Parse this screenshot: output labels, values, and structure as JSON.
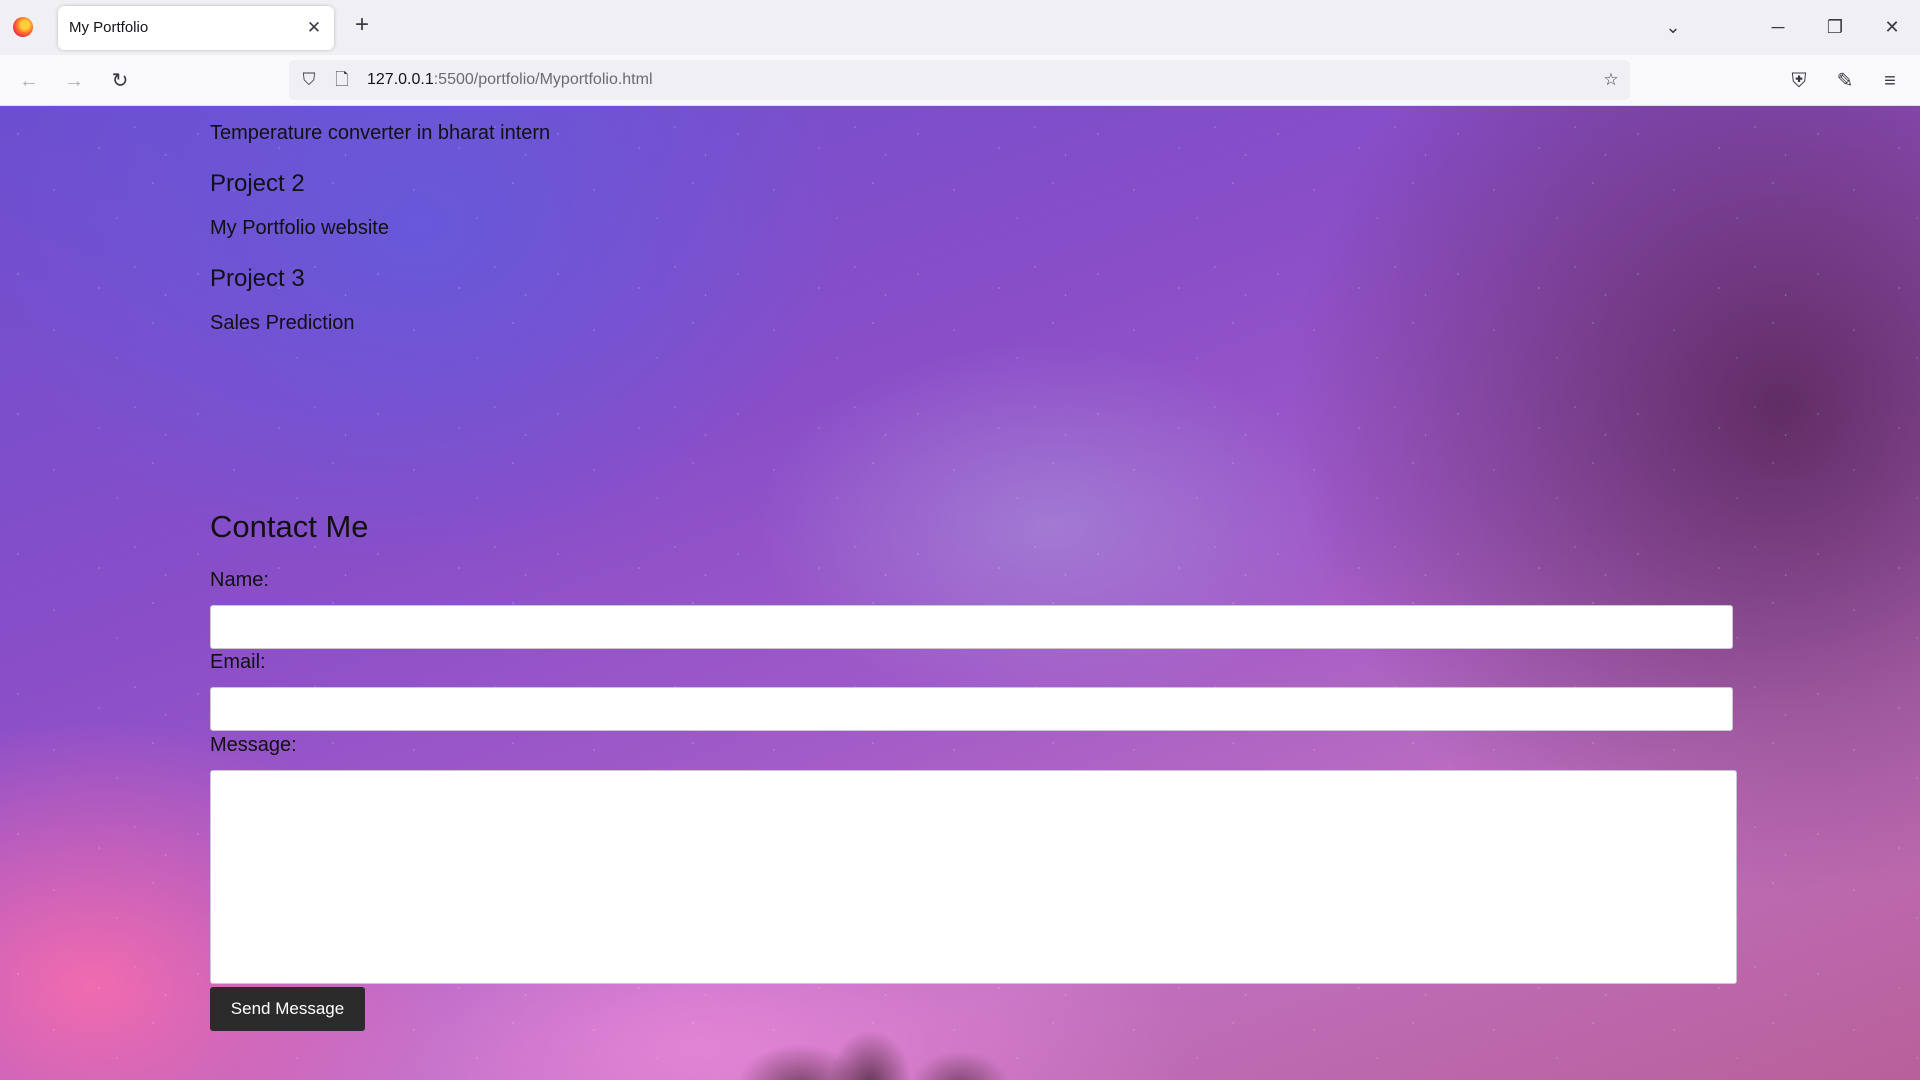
{
  "browser": {
    "tab_title": "My Portfolio",
    "tab_close": "✕",
    "new_tab": "+",
    "url_host": "127.0.0.1",
    "url_rest": ":5500/portfolio/Myportfolio.html",
    "icons": {
      "back": "←",
      "forward": "→",
      "reload": "↻",
      "shield": "⛉",
      "page": "🗋",
      "bookmark": "☆",
      "pocket": "⛨",
      "extensions": "✎",
      "menu": "≡",
      "list_tabs": "⌄",
      "minimize": "─",
      "restore": "❐",
      "close": "✕"
    }
  },
  "projects": {
    "p1_desc": "Temperature converter in bharat intern",
    "p2_title": "Project 2",
    "p2_desc": "My Portfolio website",
    "p3_title": "Project 3",
    "p3_desc": "Sales Prediction"
  },
  "contact": {
    "heading": "Contact Me",
    "name_label": "Name:",
    "email_label": "Email:",
    "message_label": "Message:",
    "name_value": "",
    "email_value": "",
    "message_value": "",
    "send_label": "Send Message"
  }
}
